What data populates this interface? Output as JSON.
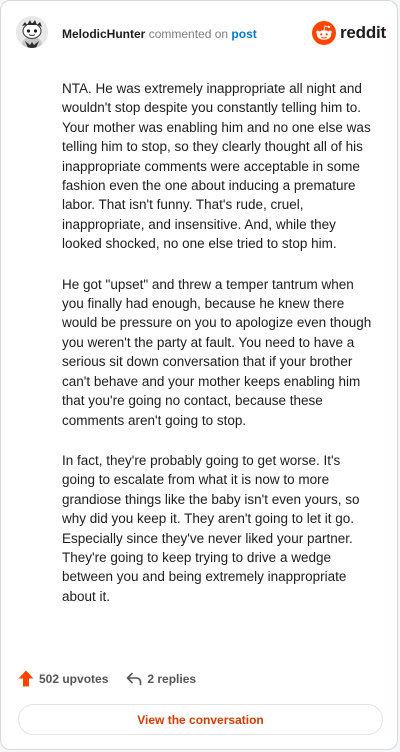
{
  "header": {
    "username": "MelodicHunter",
    "action_text": "commented on",
    "post_link": "post",
    "brand": "reddit",
    "brand_color": "#ff4500"
  },
  "comment": {
    "paragraphs": [
      "NTA. He was extremely inappropriate all night and wouldn't stop despite you constantly telling him to. Your mother was enabling him and no one else was telling him to stop, so they clearly thought all of his inappropriate comments were acceptable in some fashion even the one about inducing a premature labor. That isn't funny. That's rude, cruel, inappropriate, and insensitive. And, while they looked shocked, no one else tried to stop him.",
      "He got \"upset\" and threw a temper tantrum when you finally had enough, because he knew there would be pressure on you to apologize even though you weren't the party at fault. You need to have a serious sit down conversation that if your brother can't behave and your mother keeps enabling him that you're going no contact, because these comments aren't going to stop.",
      "In fact, they're probably going to get worse. It's going to escalate from what it is now to more grandiose things like the baby isn't even yours, so why did you keep it. They aren't going to let it go. Especially since they've never liked your partner. They're going to keep trying to drive a wedge between you and being extremely inappropriate about it."
    ]
  },
  "footer": {
    "upvotes": "502 upvotes",
    "replies": "2 replies",
    "upvote_icon": "upvote-arrow-icon",
    "reply_icon": "reply-arrow-icon",
    "upvote_color": "#ff4500"
  },
  "view_button": {
    "label": "View the conversation",
    "color": "#d93a00"
  }
}
